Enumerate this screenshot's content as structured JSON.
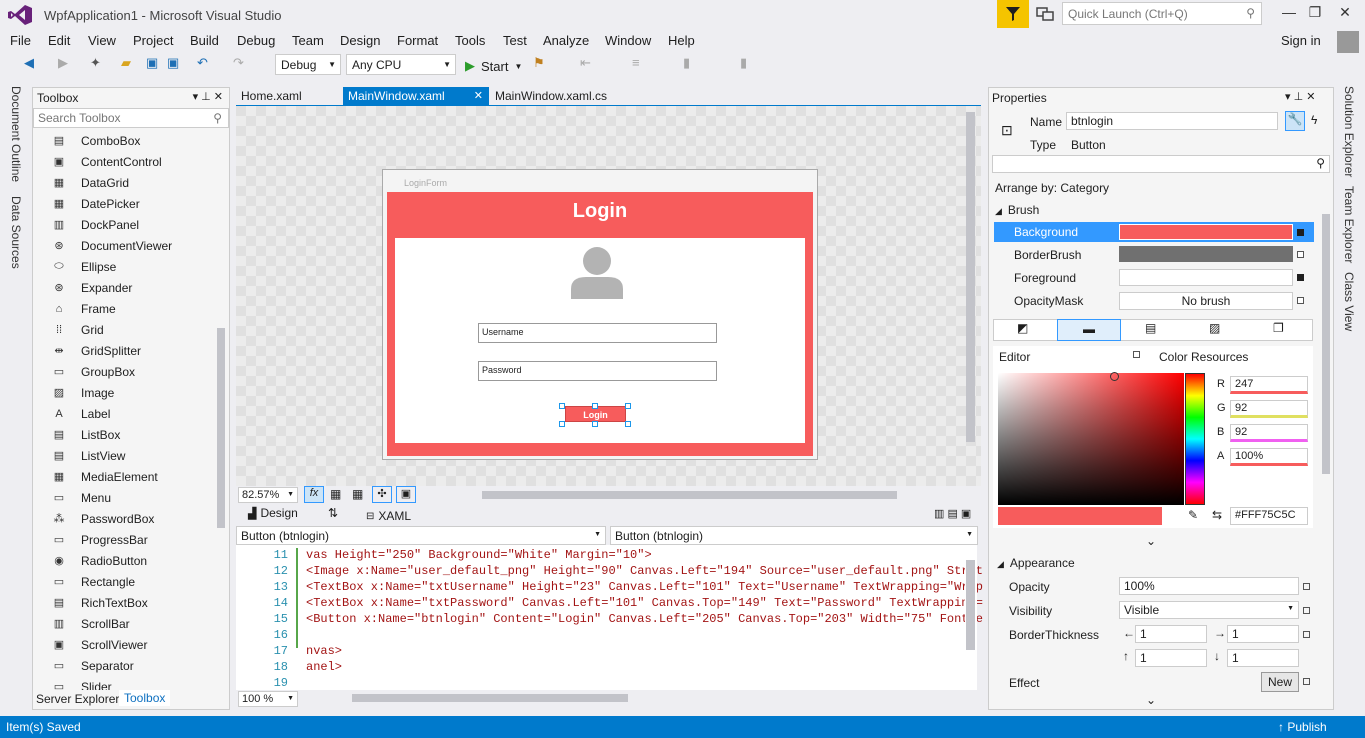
{
  "window": {
    "title": "WpfApplication1 - Microsoft Visual Studio"
  },
  "quick_launch": {
    "placeholder": "Quick Launch (Ctrl+Q)"
  },
  "menu": [
    "File",
    "Edit",
    "View",
    "Project",
    "Build",
    "Debug",
    "Team",
    "Design",
    "Format",
    "Tools",
    "Test",
    "Analyze",
    "Window",
    "Help"
  ],
  "sign_in": "Sign in",
  "toolbar": {
    "config": "Debug",
    "platform": "Any CPU",
    "start": "Start"
  },
  "side_tabs": {
    "left": [
      "Document Outline",
      "Data Sources"
    ],
    "right": [
      "Solution Explorer",
      "Team Explorer",
      "Class View"
    ]
  },
  "toolbox": {
    "title": "Toolbox",
    "search_placeholder": "Search Toolbox",
    "items": [
      {
        "label": "ComboBox",
        "icon": "combobox-icon",
        "glyph": "▤"
      },
      {
        "label": "ContentControl",
        "icon": "contentcontrol-icon",
        "glyph": "▣"
      },
      {
        "label": "DataGrid",
        "icon": "datagrid-icon",
        "glyph": "▦"
      },
      {
        "label": "DatePicker",
        "icon": "datepicker-icon",
        "glyph": "▦"
      },
      {
        "label": "DockPanel",
        "icon": "dockpanel-icon",
        "glyph": "▥"
      },
      {
        "label": "DocumentViewer",
        "icon": "documentviewer-icon",
        "glyph": "⊛"
      },
      {
        "label": "Ellipse",
        "icon": "ellipse-icon",
        "glyph": "⬭"
      },
      {
        "label": "Expander",
        "icon": "expander-icon",
        "glyph": "⊛"
      },
      {
        "label": "Frame",
        "icon": "frame-icon",
        "glyph": "⌂"
      },
      {
        "label": "Grid",
        "icon": "grid-icon",
        "glyph": "⁞⁞"
      },
      {
        "label": "GridSplitter",
        "icon": "gridsplitter-icon",
        "glyph": "⇹"
      },
      {
        "label": "GroupBox",
        "icon": "groupbox-icon",
        "glyph": "▭"
      },
      {
        "label": "Image",
        "icon": "image-icon",
        "glyph": "▨"
      },
      {
        "label": "Label",
        "icon": "label-icon",
        "glyph": "A"
      },
      {
        "label": "ListBox",
        "icon": "listbox-icon",
        "glyph": "▤"
      },
      {
        "label": "ListView",
        "icon": "listview-icon",
        "glyph": "▤"
      },
      {
        "label": "MediaElement",
        "icon": "mediaelement-icon",
        "glyph": "▦"
      },
      {
        "label": "Menu",
        "icon": "menu-icon",
        "glyph": "▭"
      },
      {
        "label": "PasswordBox",
        "icon": "passwordbox-icon",
        "glyph": "⁂"
      },
      {
        "label": "ProgressBar",
        "icon": "progressbar-icon",
        "glyph": "▭"
      },
      {
        "label": "RadioButton",
        "icon": "radiobutton-icon",
        "glyph": "◉"
      },
      {
        "label": "Rectangle",
        "icon": "rectangle-icon",
        "glyph": "▭"
      },
      {
        "label": "RichTextBox",
        "icon": "richtextbox-icon",
        "glyph": "▤"
      },
      {
        "label": "ScrollBar",
        "icon": "scrollbar-icon",
        "glyph": "▥"
      },
      {
        "label": "ScrollViewer",
        "icon": "scrollviewer-icon",
        "glyph": "▣"
      },
      {
        "label": "Separator",
        "icon": "separator-icon",
        "glyph": "▭"
      },
      {
        "label": "Slider",
        "icon": "slider-icon",
        "glyph": "▭"
      }
    ],
    "bottom_tabs": [
      "Server Explorer",
      "Toolbox"
    ]
  },
  "doc_tabs": [
    "Home.xaml",
    "MainWindow.xaml",
    "MainWindow.xaml.cs"
  ],
  "designer": {
    "window_title": "LoginForm",
    "heading": "Login",
    "username": "Username",
    "password": "Password",
    "button": "Login",
    "zoom": "82.57%"
  },
  "split": {
    "design": "Design",
    "xaml": "XAML"
  },
  "nav": {
    "left": "Button (btnlogin)",
    "right": "Button (btnlogin)"
  },
  "code": {
    "zoom": "100 %",
    "lines": [
      {
        "n": "11",
        "t": "vas Height=\"250\" Background=\"White\" Margin=\"10\">"
      },
      {
        "n": "12",
        "t": "<Image x:Name=\"user_default_png\" Height=\"90\" Canvas.Left=\"194\" Source=\"user_default.png\" Stret"
      },
      {
        "n": "13",
        "t": "<TextBox x:Name=\"txtUsername\" Height=\"23\" Canvas.Left=\"101\" Text=\"Username\" TextWrapping=\"Wrap"
      },
      {
        "n": "14",
        "t": "<TextBox x:Name=\"txtPassword\" Canvas.Left=\"101\" Canvas.Top=\"149\" Text=\"Password\" TextWrapping="
      },
      {
        "n": "15",
        "t": "<Button x:Name=\"btnlogin\" Content=\"Login\" Canvas.Left=\"205\" Canvas.Top=\"203\" Width=\"75\" FontWe"
      },
      {
        "n": "16",
        "t": ""
      },
      {
        "n": "17",
        "t": "nvas>"
      },
      {
        "n": "18",
        "t": "anel>"
      },
      {
        "n": "19",
        "t": ""
      }
    ]
  },
  "properties": {
    "title": "Properties",
    "name_label": "Name",
    "name_value": "btnlogin",
    "type_label": "Type",
    "type_value": "Button",
    "arrange": "Arrange by: Category",
    "brush": "Brush",
    "brush_rows": [
      "Background",
      "BorderBrush",
      "Foreground",
      "OpacityMask"
    ],
    "opacity_mask_value": "No brush",
    "editor": "Editor",
    "color_resources": "Color Resources",
    "r": "247",
    "g": "92",
    "b": "92",
    "a": "100%",
    "hex": "#FFF75C5C",
    "appearance": "Appearance",
    "opacity_label": "Opacity",
    "opacity": "100%",
    "visibility_label": "Visibility",
    "visibility": "Visible",
    "border_label": "BorderThickness",
    "b1": "1",
    "b2": "1",
    "b3": "1",
    "b4": "1",
    "effect_label": "Effect",
    "new_btn": "New"
  },
  "status": {
    "text": "Item(s) Saved",
    "publish": "Publish"
  },
  "colors": {
    "accent": "#007acc",
    "brush": "#f75c5c",
    "vs_purple": "#68217a"
  }
}
